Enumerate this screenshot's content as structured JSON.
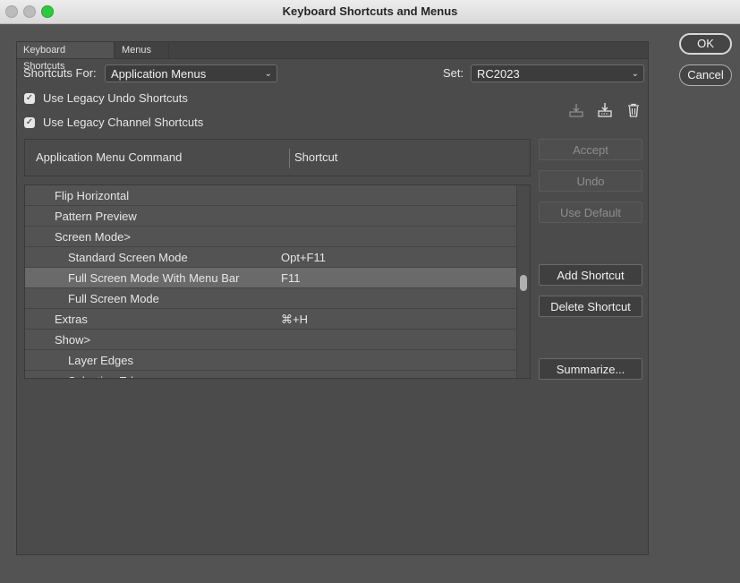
{
  "window": {
    "title": "Keyboard Shortcuts and Menus"
  },
  "tabs": [
    {
      "label": "Keyboard Shortcuts",
      "active": true
    },
    {
      "label": "Menus",
      "active": false
    }
  ],
  "shortcuts_for": {
    "label": "Shortcuts For:",
    "value": "Application Menus"
  },
  "set": {
    "label": "Set:",
    "value": "RC2023"
  },
  "checkboxes": [
    {
      "label": "Use Legacy Undo Shortcuts",
      "checked": true
    },
    {
      "label": "Use Legacy Channel Shortcuts",
      "checked": true
    }
  ],
  "icons": [
    "save-set-icon",
    "save-set-as-icon",
    "delete-set-icon"
  ],
  "table": {
    "headers": {
      "command": "Application Menu Command",
      "shortcut": "Shortcut"
    },
    "rows": [
      {
        "command": "Flip Horizontal",
        "shortcut": "",
        "indent": 1
      },
      {
        "command": "Pattern Preview",
        "shortcut": "",
        "indent": 1
      },
      {
        "command": "Screen Mode>",
        "shortcut": "",
        "indent": 1
      },
      {
        "command": "Standard Screen Mode",
        "shortcut": "Opt+F11",
        "indent": 2
      },
      {
        "command": "Full Screen Mode With Menu Bar",
        "shortcut": "F11",
        "indent": 2,
        "selected": true
      },
      {
        "command": "Full Screen Mode",
        "shortcut": "",
        "indent": 2
      },
      {
        "command": "Extras",
        "shortcut": "⌘+H",
        "indent": 1
      },
      {
        "command": "Show>",
        "shortcut": "",
        "indent": 1
      },
      {
        "command": "Layer Edges",
        "shortcut": "",
        "indent": 2
      },
      {
        "command": "Selection Edges",
        "shortcut": "",
        "indent": 2
      }
    ]
  },
  "side_buttons": {
    "accept": "Accept",
    "undo": "Undo",
    "use_default": "Use Default",
    "add_shortcut": "Add Shortcut",
    "delete_shortcut": "Delete Shortcut",
    "summarize": "Summarize..."
  },
  "dialog_buttons": {
    "ok": "OK",
    "cancel": "Cancel"
  },
  "colors": {
    "traffic_green": "#2ec840",
    "panel": "#4b4b4b",
    "selected_row": "#6a6a6a"
  }
}
